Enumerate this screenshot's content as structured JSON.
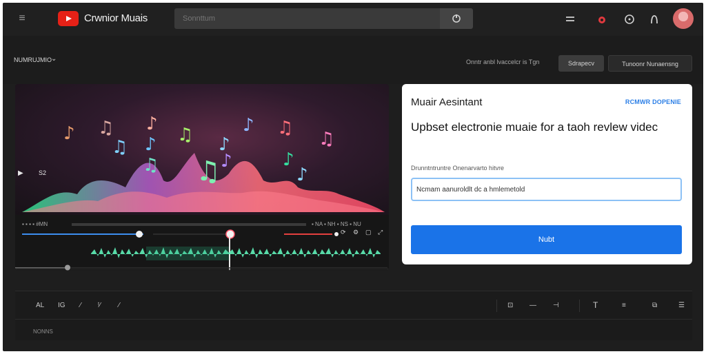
{
  "header": {
    "app_title": "Crwnior Muais",
    "search_placeholder": "Sonnttum",
    "search_icon": "mic-icon",
    "icons": [
      "grid-icon",
      "notification-bell-icon",
      "clock-icon",
      "profile-outline-icon"
    ]
  },
  "toolbar": {
    "dropdown_label": "NUMRUJMIO",
    "options_text": "Onntr anbl lvaccelcr is Tgn",
    "secondary_button": "Sdrapecv",
    "tertiary_button": "Tunoonr  Nunaensng"
  },
  "player": {
    "top_left_label": "▪ ▪ ▪ ▪ #MN",
    "top_right_label": "▪ NA ▪ NH ▪ NS ▪ NU",
    "time": "S2",
    "accent": "#ff5a6e"
  },
  "assistant": {
    "title": "Muair Aesintant",
    "link": "RCMWR DOPENIE",
    "prompt": "Upbset electronie muaie for a taoh revlew videc",
    "field_label": "Drunntntruntre Onenarvarto hitvre",
    "input_value": "Ncmam aanuroldlt dc a hmlemetold",
    "button_label": "Nubt"
  },
  "editor": {
    "tools_left": [
      "AL",
      "IG",
      "⁄",
      "ᵗ⁄",
      "⁄"
    ],
    "caption": "NONNS"
  }
}
